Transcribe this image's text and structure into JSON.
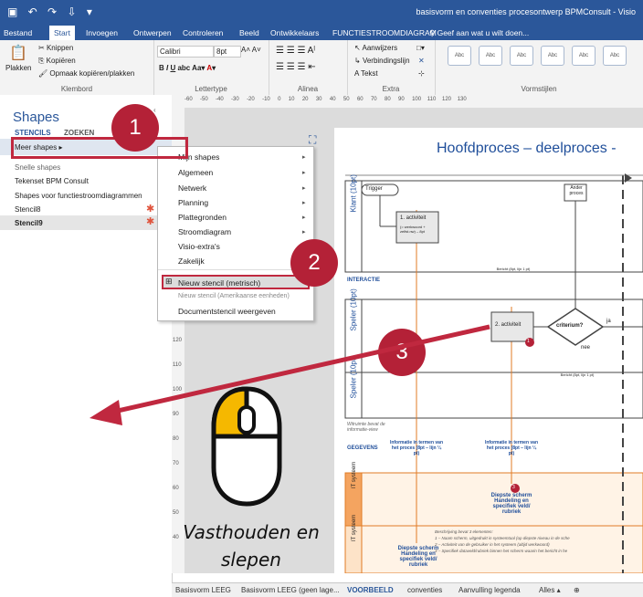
{
  "window": {
    "title": "basisvorm en conventies procesontwerp BPMConsult - Visio"
  },
  "ribbon_tabs": [
    "Bestand",
    "Start",
    "Invoegen",
    "Ontwerpen",
    "Controleren",
    "Beeld",
    "Ontwikkelaars",
    "FUNCTIESTROOMDIAGRAM"
  ],
  "tell_me": "Geef aan wat u wilt doen...",
  "clipboard": {
    "paste": "Plakken",
    "cut": "Knippen",
    "copy": "Kopiëren",
    "format_painter": "Opmaak kopiëren/plakken",
    "group": "Klembord"
  },
  "font": {
    "family": "Calibri",
    "size": "8pt",
    "group": "Lettertype"
  },
  "paragraph": {
    "group": "Alinea"
  },
  "tools": {
    "pointer": "Aanwijzers",
    "connector": "Verbindingslijn",
    "text": "Tekst",
    "group": "Extra"
  },
  "shape_styles": {
    "group": "Vormstijlen",
    "swatch": "Abc"
  },
  "shapes_pane": {
    "title": "Shapes",
    "tab_stencils": "STENCILS",
    "tab_search": "ZOEKEN",
    "items": [
      "Meer shapes",
      "Snelle shapes",
      "Tekenset BPM Consult",
      "Shapes voor functiestroomdiagrammen",
      "Stencil8",
      "Stencil9"
    ]
  },
  "menu": {
    "items": [
      "Mijn shapes",
      "Algemeen",
      "Netwerk",
      "Planning",
      "Plattegronden",
      "Stroomdiagram",
      "Visio-extra's",
      "Zakelijk",
      "Nieuw stencil (metrisch)",
      "Nieuw stencil (Amerikaanse eenheden)",
      "Documentstencil weergeven"
    ]
  },
  "diagram": {
    "title": "Hoofdproces – deelproces -",
    "lane_klant": "Klant (10pt)",
    "lane_speler1": "Speler (10pt)",
    "lane_speler2": "Speler (10pt)",
    "interactie": "INTERACTIE",
    "gegevens": "GEGEVENS",
    "it_systeem": "IT systeem",
    "trigger": "Trigger",
    "activiteit1": "1. activiteit",
    "activiteit1_sub": "(= werkwoord + zelfst.nw) – 8pt",
    "activiteit2": "2. activiteit",
    "ander_proces": "Ander proces",
    "criterium": "criterium?",
    "ja": "ja",
    "nee": "nee",
    "bericht": "Bericht (8pt, lijn 1 pt)",
    "info1": "Informatie in termen van het proces (8pt – lijn ¼ pt)",
    "info2": "Informatie in termen van het proces (8pt – lijn ¼ pt)",
    "note_view": "Witruimte bevat de informatie-view",
    "scherm": "Diepste scherm Handeling en specifiek veld/ rubriek",
    "scherm2": "Diepste scherm Handeling en specifiek veld/ rubriek",
    "beschrijving": "Beschrijving bevat 3 elementen:",
    "beschrijving1": "1 – Naam scherm, uitgedrukt in systeemtaal (op diepste niveau in de sche",
    "beschrijving2": "2 – Activiteit van de gebruiker in het systeem (altijd werkwoord)",
    "beschrijving3": "3 – Specifiek dataveld/rubriek binnen het scherm waarin het bericht in he",
    "badge1": "1",
    "badge3": "3",
    "ruler_marks": [
      "-60",
      "-50",
      "-40",
      "-30",
      "-20",
      "-10",
      "0",
      "10",
      "20",
      "30",
      "40",
      "50",
      "60",
      "70",
      "80",
      "90",
      "100",
      "110",
      "120",
      "130"
    ],
    "ruler_left_marks": [
      "120",
      "110",
      "100",
      "90",
      "80",
      "70",
      "60",
      "50",
      "40",
      "30",
      "20"
    ]
  },
  "annotations": {
    "step1": "1",
    "step2": "2",
    "step3": "3",
    "mouse_caption_1": "Vasthouden en",
    "mouse_caption_2": "slepen"
  },
  "sheet_tabs": [
    "Basisvorm LEEG",
    "Basisvorm LEEG (geen lage...",
    "VOORBEELD",
    "conventies",
    "Aanvulling legenda",
    "Alles ▴"
  ],
  "colors": {
    "accent": "#2b579a",
    "badge": "#b42137",
    "highlight": "#c0283f",
    "arrow": "#c0283f",
    "mouse_yellow": "#f5b800"
  }
}
